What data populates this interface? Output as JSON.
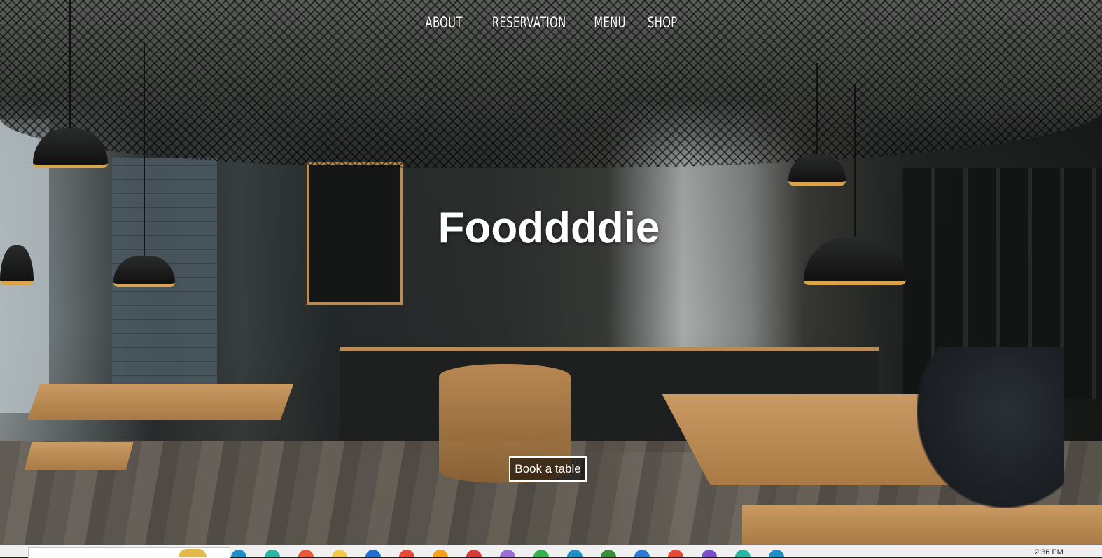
{
  "nav": {
    "items": [
      {
        "label": "ABOUT"
      },
      {
        "label": "RESERVATION"
      },
      {
        "label": "MENU"
      },
      {
        "label": "SHOP"
      }
    ]
  },
  "hero": {
    "title": "Fooddddie",
    "cta_label": "Book a table",
    "background": "cafe-interior-photo"
  },
  "taskbar": {
    "time": "2:36 PM",
    "icons": [
      "folder-icon",
      "chrome-icon",
      "edge-icon",
      "files-icon",
      "mail-icon",
      "store-icon",
      "app-icon",
      "app-icon",
      "app-icon",
      "app-icon",
      "app-icon",
      "app-icon",
      "app-icon",
      "app-icon",
      "app-icon",
      "app-icon",
      "app-icon",
      "app-icon",
      "app-icon",
      "app-icon",
      "app-icon",
      "app-icon",
      "app-icon",
      "app-icon",
      "app-icon",
      "app-icon",
      "app-icon",
      "app-icon",
      "app-icon"
    ],
    "icon_colors": [
      "#1e90c8",
      "#2bb6a3",
      "#e85b3a",
      "#f2c94c",
      "#1f6fd1",
      "#e84a3a",
      "#f7a21b",
      "#d23c3c",
      "#9a6fd6",
      "#35b04a",
      "#1e90c8",
      "#3d8d3d",
      "#2a7ad6",
      "#e84a3a",
      "#7c4fc9",
      "#2bb6a3",
      "#1e90c8"
    ]
  }
}
